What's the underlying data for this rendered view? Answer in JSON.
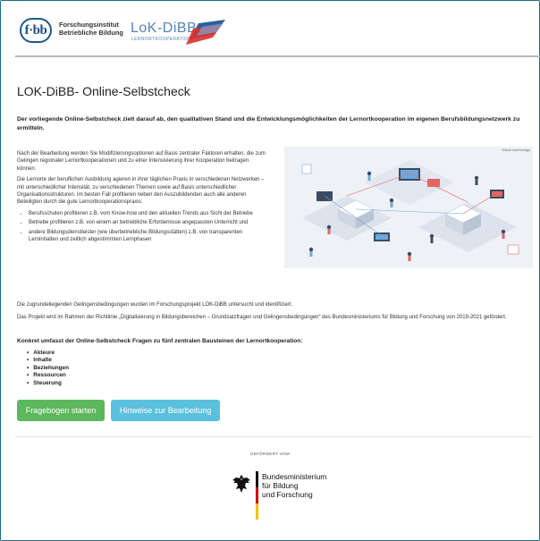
{
  "header": {
    "fbb_logo_text": "f·bb",
    "fbb_org_line1": "Forschungsinstitut",
    "fbb_org_line2": "Betriebliche Bildung",
    "lok_title": "LoK-DiBB",
    "lok_subtitle": "LERNORTKOOPERATION"
  },
  "page": {
    "title": "LOK-DiBB- Online-Selbstcheck",
    "lead": "Der vorliegende Online-Selbstcheck zielt darauf ab, den qualitativen Stand und die Entwicklungsmöglichkeiten der Lernortkooperation im eigenen Berufsbildungsnetzwerk zu ermitteln.",
    "intro_p1": "Nach der Bearbeitung werden Sie Modifizierungsoptionen auf Basis zentraler Faktoren erhalten, die zum Gelingen regionaler Lernortkooperationen und zu einer Intensivierung ihrer Kooperation beitragen können.",
    "intro_p2": "Die Lernorte der beruflichen Ausbildung agieren in ihrer täglichen Praxis in verschiedenen Netzwerken – mit unterschiedlicher Intensität, zu verschiedenen Themen sowie auf Basis unterschiedlicher Organisationsstrukturen. Im besten Fall profitieren neben den Auszubildenden auch alle anderen Beteiligten durch die gute Lernortkooperationspraxis:",
    "benefits": [
      "Berufsschulen profitieren z.B. vom Know-how und den aktuellen Trends aus Sicht der Betriebe",
      "Betriebe profitieren z.B. von einem an betriebliche Erfordernisse angepassten Unterricht und",
      "andere Bildungsdienstleister (wie überbetriebliche Bildungsstätten) z.B. von transparenten Lerninhalten und zeitlich abgestimmten Lernphasen"
    ],
    "image_credit": "iStock.com/Vertigo",
    "para_conditions": "Die zugrundeliegenden Gelingensbedingungen wurden im Forschungsprojekt LOK-DiBB untersucht und identifiziert.",
    "para_funding": "Das Projekt wird im Rahmen der Richtlinie „Digitalisierung in Bildungsbereichen – Grundsatzfragen und Gelingensbedingungen“ des Bundesministeriums für Bildung und Forschung von 2019-2021 gefördert.",
    "blocks_heading": "Konkret umfasst der Online-Selbstcheck Fragen zu fünf zentralen Bausteinen der Lernortkooperation:",
    "blocks": [
      "Akteure",
      "Inhalte",
      "Beziehungen",
      "Ressourcen",
      "Steuerung"
    ]
  },
  "actions": {
    "start_label": "Fragebogen starten",
    "hints_label": "Hinweise zur Bearbeitung"
  },
  "footer": {
    "funded_by": "GEFÖRDERT VOM",
    "ministry_line1": "Bundesministerium",
    "ministry_line2": "für Bildung",
    "ministry_line3": "und Forschung"
  },
  "colors": {
    "start_button": "#5cb85c",
    "hints_button": "#5bc0de",
    "frame_border": "#1a6f86",
    "logo_blue": "#5582b5"
  }
}
